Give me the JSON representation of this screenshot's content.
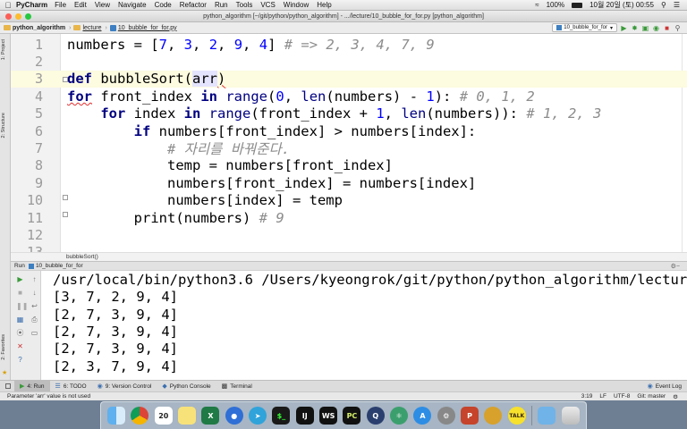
{
  "menubar": {
    "app": "PyCharm",
    "items": [
      "File",
      "Edit",
      "View",
      "Navigate",
      "Code",
      "Refactor",
      "Run",
      "Tools",
      "VCS",
      "Window",
      "Help"
    ],
    "battery": "100%",
    "datetime": "10월 20일 (토) 00:55"
  },
  "window": {
    "title": "python_algorithm [~/git/python/python_algorithm] - .../lecture/10_bubble_for_for.py [python_algorithm]"
  },
  "navbar": {
    "project": "python_algorithm",
    "folder": "lecture",
    "file": "10_bubble_for_for.py",
    "run_config": "10_bubble_for_for"
  },
  "side_tabs": {
    "project": "1: Project",
    "structure": "2: Structure",
    "favorites": "2: Favorites"
  },
  "editor": {
    "lines": [
      {
        "n": "1"
      },
      {
        "n": "2"
      },
      {
        "n": "3"
      },
      {
        "n": "4"
      },
      {
        "n": "5"
      },
      {
        "n": "6"
      },
      {
        "n": "7"
      },
      {
        "n": "8"
      },
      {
        "n": "9"
      },
      {
        "n": "10"
      },
      {
        "n": "11"
      },
      {
        "n": "12"
      },
      {
        "n": "13"
      }
    ],
    "tokens": {
      "l1_a": "numbers = [",
      "l1_n1": "7",
      "l1_c1": ", ",
      "l1_n2": "3",
      "l1_c2": ", ",
      "l1_n3": "2",
      "l1_c3": ", ",
      "l1_n4": "9",
      "l1_c4": ", ",
      "l1_n5": "4",
      "l1_b": "] ",
      "l1_cm": "# => 2, 3, 4, 7, 9",
      "l3_kw": "def",
      "l3_sp": " ",
      "l3_fn": "bubbleSort",
      "l3_p1": "(",
      "l3_param": "arr",
      "l3_p2": ")",
      "l4_kw": "for",
      "l4_a": " front_index ",
      "l4_in": "in",
      "l4_sp": " ",
      "l4_range": "range",
      "l4_b": "(",
      "l4_n0": "0",
      "l4_c": ", ",
      "l4_len": "len",
      "l4_d": "(numbers) - ",
      "l4_n1": "1",
      "l4_e": "): ",
      "l4_cm": "# 0, 1, 2",
      "l5_ind": "    ",
      "l5_kw": "for",
      "l5_a": " index ",
      "l5_in": "in",
      "l5_sp": " ",
      "l5_range": "range",
      "l5_b": "(front_index + ",
      "l5_n1": "1",
      "l5_c": ", ",
      "l5_len": "len",
      "l5_d": "(numbers)): ",
      "l5_cm": "# 1, 2, 3",
      "l6_ind": "        ",
      "l6_kw": "if",
      "l6_a": " numbers[front_index] > numbers[index]:",
      "l7_ind": "            ",
      "l7_cm": "# 자리를 바꿔준다.",
      "l8": "            temp = numbers[front_index]",
      "l9": "            numbers[front_index] = numbers[index]",
      "l10": "            numbers[index] = temp",
      "l11_ind": "        ",
      "l11_fn": "print",
      "l11_a": "(numbers) ",
      "l11_cm": "# 9"
    }
  },
  "code_breadcrumb": "bubbleSort()",
  "run_panel": {
    "header": "Run",
    "config": "10_bubble_for_for",
    "output": [
      "/usr/local/bin/python3.6 /Users/kyeongrok/git/python/python_algorithm/lecture/10_bubble_for_for.py",
      "[3, 7, 2, 9, 4]",
      "[2, 7, 3, 9, 4]",
      "[2, 7, 3, 9, 4]",
      "[2, 7, 3, 9, 4]",
      "[2, 3, 7, 9, 4]"
    ]
  },
  "tool_tabs": {
    "run": "4: Run",
    "todo": "6: TODO",
    "vcs": "9: Version Control",
    "console": "Python Console",
    "terminal": "Terminal",
    "event_log": "Event Log"
  },
  "status": {
    "message": "Parameter 'arr' value is not used",
    "position": "3:19",
    "line_sep": "LF",
    "encoding": "UTF-8",
    "git": "Git: master"
  },
  "dock": {
    "calendar_day": "20"
  },
  "colors": {
    "keyword": "#000080",
    "number": "#0000ff",
    "comment": "#8c8c8c",
    "current_line": "#fdfbe0"
  }
}
